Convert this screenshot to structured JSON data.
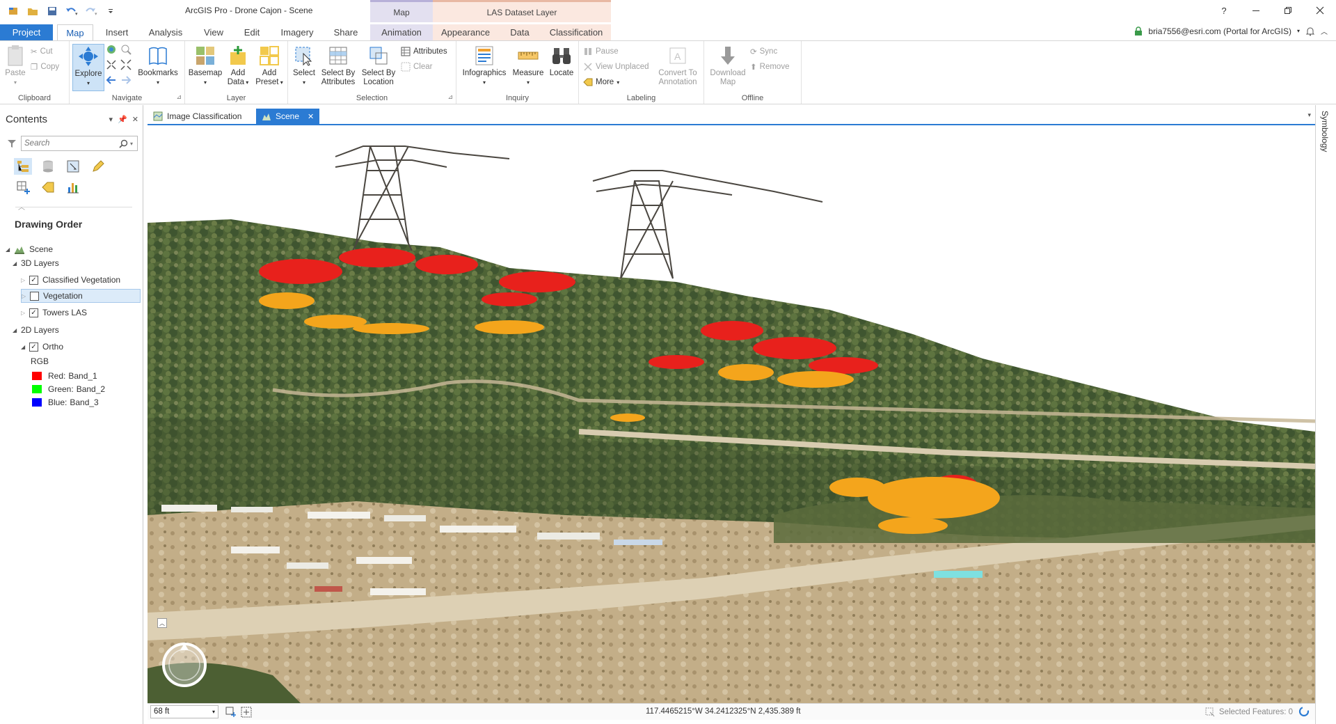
{
  "window": {
    "title": "ArcGIS Pro - Drone Cajon - Scene",
    "help": "?",
    "ctx_map": "Map",
    "ctx_las": "LAS Dataset Layer"
  },
  "tabs": {
    "project": "Project",
    "map": "Map",
    "insert": "Insert",
    "analysis": "Analysis",
    "view": "View",
    "edit": "Edit",
    "imagery": "Imagery",
    "share": "Share",
    "animation": "Animation",
    "appearance": "Appearance",
    "data": "Data",
    "classification": "Classification"
  },
  "user": {
    "account": "bria7556@esri.com (Portal for ArcGIS)"
  },
  "ribbon": {
    "clipboard": {
      "label": "Clipboard",
      "paste": "Paste",
      "cut": "Cut",
      "copy": "Copy"
    },
    "navigate": {
      "label": "Navigate",
      "explore": "Explore",
      "bookmarks": "Bookmarks"
    },
    "layer": {
      "label": "Layer",
      "basemap": "Basemap",
      "add_data_1": "Add",
      "add_data_2": "Data",
      "add_preset_1": "Add",
      "add_preset_2": "Preset"
    },
    "selection": {
      "label": "Selection",
      "select": "Select",
      "sba_1": "Select By",
      "sba_2": "Attributes",
      "sbl_1": "Select By",
      "sbl_2": "Location",
      "attributes": "Attributes",
      "clear": "Clear"
    },
    "inquiry": {
      "label": "Inquiry",
      "infographics": "Infographics",
      "measure": "Measure",
      "locate": "Locate"
    },
    "labeling": {
      "label": "Labeling",
      "pause": "Pause",
      "view_unplaced": "View Unplaced",
      "more": "More",
      "cta_1": "Convert To",
      "cta_2": "Annotation"
    },
    "offline": {
      "label": "Offline",
      "download_1": "Download",
      "download_2": "Map",
      "sync": "Sync",
      "remove": "Remove"
    }
  },
  "contents": {
    "title": "Contents",
    "search_placeholder": "Search",
    "drawing_order": "Drawing Order",
    "scene": "Scene",
    "group_3d": "3D Layers",
    "layer_classified": "Classified Vegetation",
    "layer_vegetation": "Vegetation",
    "layer_towers": "Towers LAS",
    "group_2d": "2D Layers",
    "layer_ortho": "Ortho",
    "rgb": "RGB",
    "bands": [
      {
        "label": "Red:",
        "value": "Band_1",
        "color": "#ff0000"
      },
      {
        "label": "Green:",
        "value": "Band_2",
        "color": "#00ff00"
      },
      {
        "label": "Blue:",
        "value": "Band_3",
        "color": "#0000ff"
      }
    ]
  },
  "view_tabs": {
    "image_classification": "Image Classification",
    "scene": "Scene"
  },
  "right_dock": {
    "symbology": "Symbology"
  },
  "status": {
    "scale": "68 ft",
    "coordinates": "117.4465215°W 34.2412325°N  2,435.389 ft",
    "selected_features": "Selected Features: 0"
  },
  "colors": {
    "accent": "#2b7bd3",
    "classified_red": "#e8211c",
    "classified_orange": "#f4a51c"
  }
}
